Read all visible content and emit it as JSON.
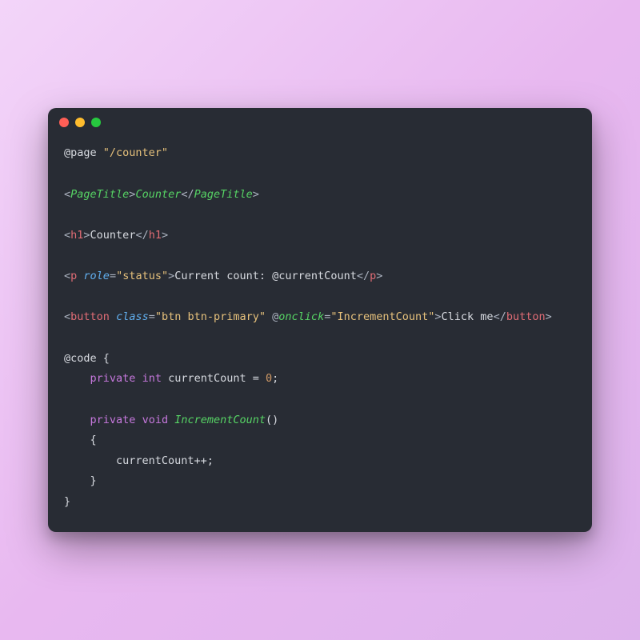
{
  "window": {
    "traffic_lights": [
      "close",
      "minimize",
      "zoom"
    ]
  },
  "code": {
    "line1_directive": "@page",
    "line1_string": "\"/counter\"",
    "line3_open_lt": "<",
    "line3_tag": "PageTitle",
    "line3_gt": ">",
    "line3_text": "Counter",
    "line3_close_lt": "</",
    "line5_open_lt": "<",
    "line5_tag": "h1",
    "line5_gt": ">",
    "line5_text": "Counter",
    "line5_close_lt": "</",
    "line7_open_lt": "<",
    "line7_tag": "p",
    "line7_attr": "role",
    "line7_eq": "=",
    "line7_val": "\"status\"",
    "line7_gt": ">",
    "line7_text": "Current count: @currentCount",
    "line7_close_lt": "</",
    "line9_open_lt": "<",
    "line9_tag": "button",
    "line9_attr1": "class",
    "line9_eq": "=",
    "line9_val1": "\"btn btn-primary\"",
    "line9_at": "@",
    "line9_event": "onclick",
    "line9_val2": "\"IncrementCount\"",
    "line9_gt": ">",
    "line9_text": "Click me",
    "line9_close_lt": "</",
    "line11_code": "@code {",
    "line12_indent": "    ",
    "line12_kw1": "private",
    "line12_kw2": "int",
    "line12_rest": " currentCount = ",
    "line12_num": "0",
    "line12_semi": ";",
    "line14_indent": "    ",
    "line14_kw1": "private",
    "line14_kw2": "void",
    "line14_method": "IncrementCount",
    "line14_parens": "()",
    "line15": "    {",
    "line16": "        currentCount++;",
    "line17": "    }",
    "line18": "}"
  }
}
